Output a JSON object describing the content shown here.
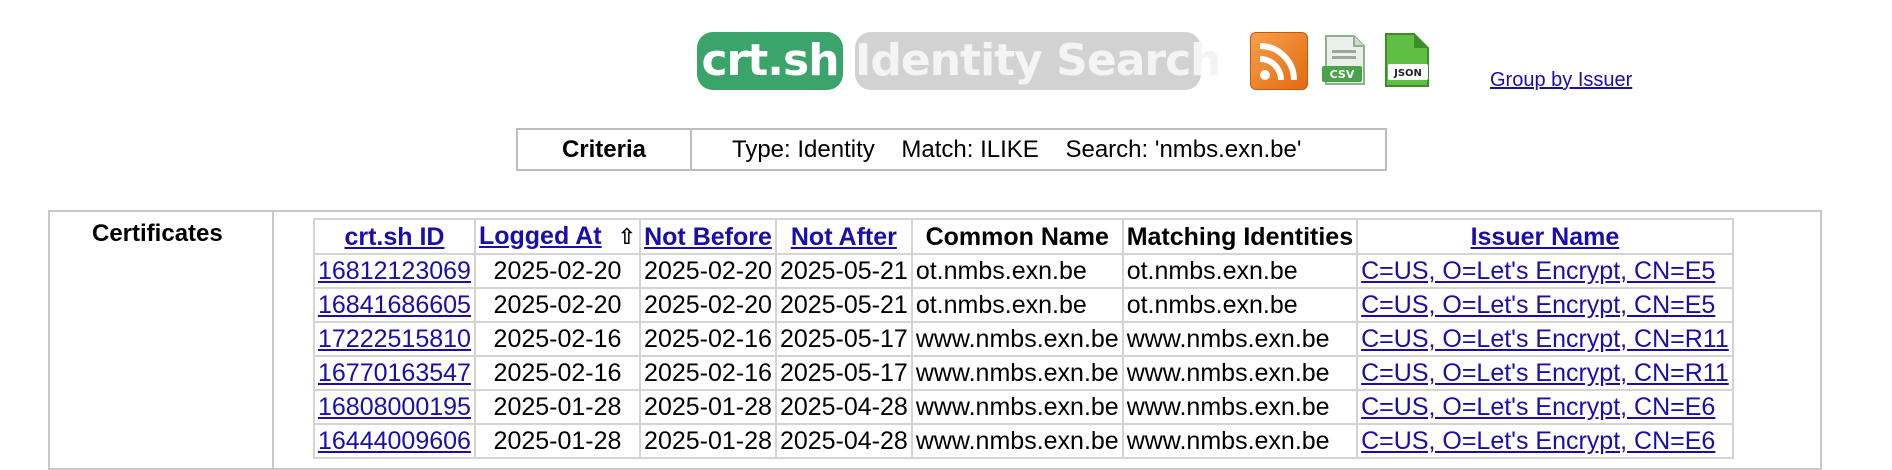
{
  "header": {
    "brand": "crt.sh",
    "subtitle": "Identity Search",
    "icons": [
      "rss-feed-icon",
      "csv-download-icon",
      "json-download-icon"
    ],
    "csv_label": "CSV",
    "json_label": "JSON",
    "group_link": "Group by Issuer",
    "colors": {
      "brand_green": "#3aa46a",
      "subtitle_gray": "#d2d2d2",
      "link": "#1a0dab"
    }
  },
  "criteria": {
    "label": "Criteria",
    "value": "Type: Identity    Match: ILIKE    Search: 'nmbs.exn.be'"
  },
  "certificates": {
    "title": "Certificates",
    "columns": [
      "crt.sh ID",
      "Logged At",
      "Not Before",
      "Not After",
      "Common Name",
      "Matching Identities",
      "Issuer Name"
    ],
    "sort_icon": "⇧",
    "rows": [
      {
        "id": "16812123069",
        "logged": "2025-02-20",
        "not_before": "2025-02-20",
        "not_after": "2025-05-21",
        "cn": "ot.nmbs.exn.be",
        "match": "ot.nmbs.exn.be",
        "issuer": "C=US, O=Let's Encrypt, CN=E5"
      },
      {
        "id": "16841686605",
        "logged": "2025-02-20",
        "not_before": "2025-02-20",
        "not_after": "2025-05-21",
        "cn": "ot.nmbs.exn.be",
        "match": "ot.nmbs.exn.be",
        "issuer": "C=US, O=Let's Encrypt, CN=E5"
      },
      {
        "id": "17222515810",
        "logged": "2025-02-16",
        "not_before": "2025-02-16",
        "not_after": "2025-05-17",
        "cn": "www.nmbs.exn.be",
        "match": "www.nmbs.exn.be",
        "issuer": "C=US, O=Let's Encrypt, CN=R11"
      },
      {
        "id": "16770163547",
        "logged": "2025-02-16",
        "not_before": "2025-02-16",
        "not_after": "2025-05-17",
        "cn": "www.nmbs.exn.be",
        "match": "www.nmbs.exn.be",
        "issuer": "C=US, O=Let's Encrypt, CN=R11"
      },
      {
        "id": "16808000195",
        "logged": "2025-01-28",
        "not_before": "2025-01-28",
        "not_after": "2025-04-28",
        "cn": "www.nmbs.exn.be",
        "match": "www.nmbs.exn.be",
        "issuer": "C=US, O=Let's Encrypt, CN=E6"
      },
      {
        "id": "16444009606",
        "logged": "2025-01-28",
        "not_before": "2025-01-28",
        "not_after": "2025-04-28",
        "cn": "www.nmbs.exn.be",
        "match": "www.nmbs.exn.be",
        "issuer": "C=US, O=Let's Encrypt, CN=E6"
      }
    ]
  }
}
